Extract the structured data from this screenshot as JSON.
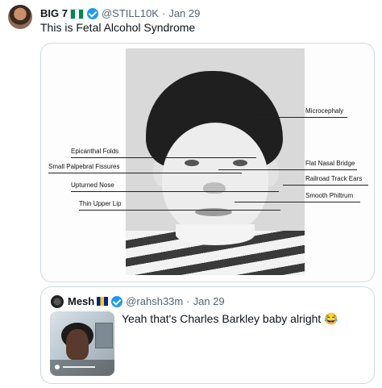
{
  "tweet": {
    "author_name": "BIG 7",
    "handle": "@STILL10K",
    "date": "Jan 29",
    "separator": "·",
    "text": "This is Fetal Alcohol Syndrome",
    "flag_icon": "nigeria-flag-icon",
    "verified_icon": "verified-badge-icon"
  },
  "diagram": {
    "labels_left": [
      "Epicanthal Folds",
      "Small Palpebral Fissures",
      "Upturned Nose",
      "Thin Upper Lip"
    ],
    "labels_right": [
      "Microcephaly",
      "Flat Nasal Bridge",
      "Railroad Track Ears",
      "Smooth Philtrum"
    ]
  },
  "quote": {
    "author_name": "Mesh",
    "handle": "@rahsh33m",
    "date": "Jan 29",
    "separator": "·",
    "text": "Yeah that's Charles Barkley baby alright 😂",
    "flag_icon": "barbados-flag-icon",
    "verified_icon": "verified-badge-icon"
  },
  "colors": {
    "verified": "#1d9bf0",
    "muted_text": "#536471",
    "border": "#cfd9de"
  }
}
